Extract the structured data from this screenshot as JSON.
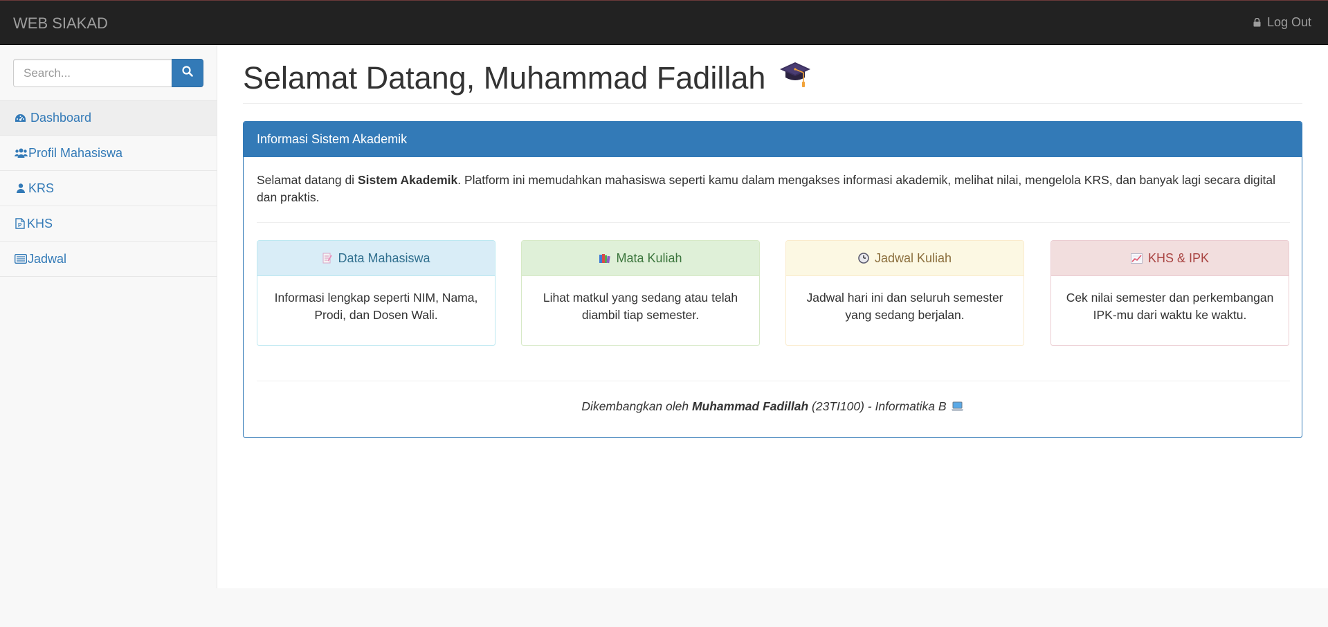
{
  "navbar": {
    "brand": "WEB SIAKAD",
    "logout_label": "Log Out",
    "logout_icon": "lock-icon"
  },
  "sidebar": {
    "search_placeholder": "Search...",
    "search_icon": "search-icon",
    "items": [
      {
        "label": "Dashboard",
        "icon": "dashboard-icon"
      },
      {
        "label": "Profil Mahasiswa",
        "icon": "users-icon"
      },
      {
        "label": "KRS",
        "icon": "user-icon"
      },
      {
        "label": "KHS",
        "icon": "file-icon"
      },
      {
        "label": "Jadwal",
        "icon": "list-icon"
      }
    ]
  },
  "main": {
    "title": "Selamat Datang, Muhammad Fadillah",
    "title_icon": "graduation-cap-icon",
    "panel": {
      "heading": "Informasi Sistem Akademik",
      "intro_prefix": "Selamat datang di ",
      "intro_bold": "Sistem Akademik",
      "intro_suffix": ". Platform ini memudahkan mahasiswa seperti kamu dalam mengakses informasi akademik, melihat nilai, mengelola KRS, dan banyak lagi secara digital dan praktis.",
      "cards": [
        {
          "title": "Data Mahasiswa",
          "icon": "memo-icon",
          "body": "Informasi lengkap seperti NIM, Nama, Prodi, dan Dosen Wali."
        },
        {
          "title": "Mata Kuliah",
          "icon": "books-icon",
          "body": "Lihat matkul yang sedang atau telah diambil tiap semester."
        },
        {
          "title": "Jadwal Kuliah",
          "icon": "clock-icon",
          "body": "Jadwal hari ini dan seluruh semester yang sedang berjalan."
        },
        {
          "title": "KHS & IPK",
          "icon": "chart-up-icon",
          "body": "Cek nilai semester dan perkembangan IPK-mu dari waktu ke waktu."
        }
      ],
      "footer": {
        "prefix": "Dikembangkan oleh ",
        "name": "Muhammad Fadillah",
        "suffix": " (23TI100) - Informatika B",
        "icon": "laptop-icon"
      }
    }
  },
  "colors": {
    "navbar_bg": "#222222",
    "primary": "#337ab7",
    "info_bg": "#d9edf7",
    "success_bg": "#dff0d8",
    "warning_bg": "#fcf8e3",
    "danger_bg": "#f2dede"
  }
}
